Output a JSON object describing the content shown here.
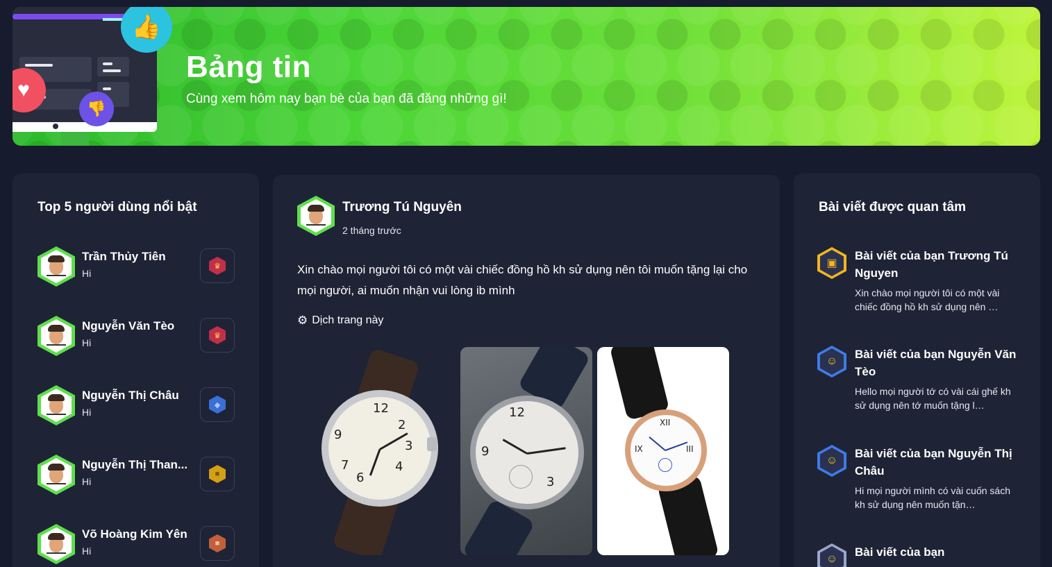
{
  "banner": {
    "title": "Bảng tin",
    "subtitle": "Cùng xem hôm nay bạn bè của bạn đã đăng những gì!"
  },
  "top_users": {
    "title": "Top 5 người dùng nổi bật",
    "users": [
      {
        "name": "Trần Thủy Tiên",
        "sub": "Hi",
        "rank_icon": "ruby-crown-icon",
        "rank_color": "#c0304a"
      },
      {
        "name": "Nguyễn Văn Tèo",
        "sub": "Hi",
        "rank_icon": "ruby-crown-icon",
        "rank_color": "#c0304a"
      },
      {
        "name": "Nguyễn Thị Châu",
        "sub": "Hi",
        "rank_icon": "sapphire-icon",
        "rank_color": "#3b6fd6"
      },
      {
        "name": "Nguyễn Thị Than...",
        "sub": "Hi",
        "rank_icon": "gold-icon",
        "rank_color": "#d4a017"
      },
      {
        "name": "Võ Hoàng Kim Yên",
        "sub": "Hi",
        "rank_icon": "bronze-icon",
        "rank_color": "#c2603a"
      }
    ]
  },
  "post": {
    "author": "Trương Tú Nguyên",
    "time": "2 tháng trước",
    "text": "Xin chào mọi người tôi có một vài chiếc đồng hồ kh sử dụng nên tôi muốn tặng lại cho mọi người, ai muốn nhận vui lòng ib mình",
    "translate_label": "Dịch trang này"
  },
  "recommended": {
    "title": "Bài viết được quan tâm",
    "items": [
      {
        "head": "Bài viết của bạn Trương Tú Nguyen",
        "body": "Xin chào mọi người tôi có một vài chiếc đồng hồ kh sử dụng nên …",
        "icon": "treasure-chest-icon",
        "icon_color": "#f2b51d"
      },
      {
        "head": "Bài viết của bạn Nguyễn Văn Tèo",
        "body": "Hello mọi người tớ có vài cái ghế kh sử dụng nên tớ muốn tặng l…",
        "icon": "smiley-icon",
        "icon_color": "#3f7be8"
      },
      {
        "head": "Bài viết của bạn Nguyễn Thị Châu",
        "body": "Hi mọi người mình có vài cuốn sách kh sử dụng nên muốn tặn…",
        "icon": "smiley-icon",
        "icon_color": "#3f7be8"
      },
      {
        "head": "Bài viết của bạn",
        "body": "",
        "icon": "smiley-icon",
        "icon_color": "#9aa5c8"
      }
    ]
  }
}
